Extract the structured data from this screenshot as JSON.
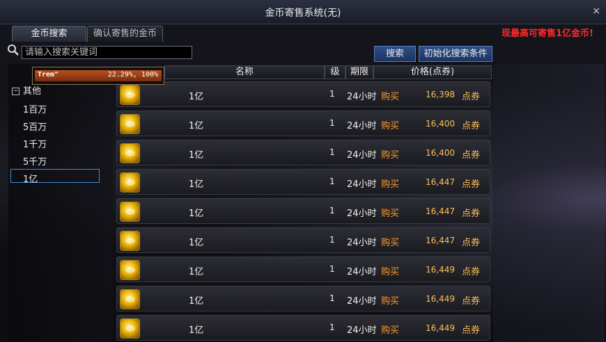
{
  "window": {
    "title": "金币寄售系统(无)",
    "close": "×"
  },
  "tabs": [
    {
      "label": "金币搜索"
    },
    {
      "label": "确认寄售的金币"
    }
  ],
  "notice": "现最高可寄售1亿金币!",
  "search": {
    "value": "请输入搜索关键词",
    "placeholder": "请输入搜索关键词",
    "search_label": "搜索",
    "reset_label": "初始化搜索条件"
  },
  "tooltip": {
    "label": "Trem\"",
    "value": "22.29%, 100%"
  },
  "categories": {
    "header": "其他",
    "items": [
      {
        "label": "1百万"
      },
      {
        "label": "5百万"
      },
      {
        "label": "1千万"
      },
      {
        "label": "5千万"
      },
      {
        "label": "1亿"
      }
    ],
    "selected_index": 4
  },
  "table": {
    "headers": {
      "name": "名称",
      "level": "级",
      "duration": "期限",
      "price": "价格(点券)"
    },
    "buy_label": "购买",
    "unit": "点券",
    "rows": [
      {
        "name": "1亿",
        "level": "1",
        "duration": "24小时",
        "price": "16,398"
      },
      {
        "name": "1亿",
        "level": "1",
        "duration": "24小时",
        "price": "16,400"
      },
      {
        "name": "1亿",
        "level": "1",
        "duration": "24小时",
        "price": "16,400"
      },
      {
        "name": "1亿",
        "level": "1",
        "duration": "24小时",
        "price": "16,447"
      },
      {
        "name": "1亿",
        "level": "1",
        "duration": "24小时",
        "price": "16,447"
      },
      {
        "name": "1亿",
        "level": "1",
        "duration": "24小时",
        "price": "16,447"
      },
      {
        "name": "1亿",
        "level": "1",
        "duration": "24小时",
        "price": "16,449"
      },
      {
        "name": "1亿",
        "level": "1",
        "duration": "24小时",
        "price": "16,449"
      },
      {
        "name": "1亿",
        "level": "1",
        "duration": "24小时",
        "price": "16,449"
      }
    ]
  }
}
